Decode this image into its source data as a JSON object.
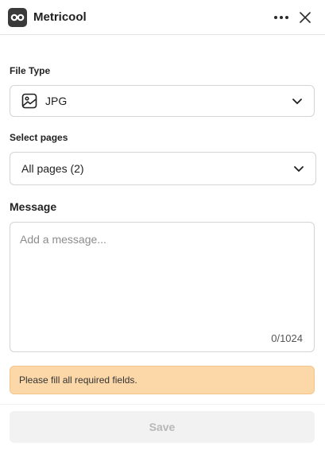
{
  "app": {
    "title": "Metricool"
  },
  "file_type": {
    "label": "File Type",
    "value": "JPG"
  },
  "pages": {
    "label": "Select pages",
    "value": "All pages (2)"
  },
  "message": {
    "label": "Message",
    "placeholder": "Add a message...",
    "counter": "0/1024"
  },
  "alert": {
    "text": "Please fill all required fields."
  },
  "save": {
    "label": "Save"
  },
  "icons": {
    "logo": "metricool-logo-icon",
    "more": "more-horizontal-icon",
    "close": "close-icon",
    "image": "image-icon",
    "chevron": "chevron-down-icon"
  },
  "colors": {
    "alert_bg": "#fcd8a9",
    "disabled_bg": "#f2f2f2",
    "logo_bg": "#3a3a3a"
  }
}
